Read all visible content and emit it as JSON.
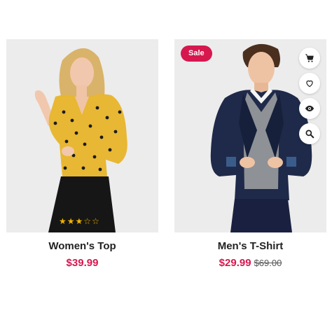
{
  "products": [
    {
      "name": "Women's Top",
      "price": "$39.99",
      "rating": 3,
      "rating_max": 5
    },
    {
      "name": "Men's T-Shirt",
      "price": "$29.99",
      "old_price": "$69.00",
      "badge": "Sale",
      "actions": [
        "cart-icon",
        "heart-icon",
        "eye-icon",
        "search-icon"
      ]
    }
  ],
  "colors": {
    "accent": "#d6184e",
    "star": "#f0b400",
    "image_bg": "#ececec",
    "top_yellow": "#e8b733",
    "jacket_navy": "#1f2a4a",
    "sweater_gray": "#8e9196"
  }
}
